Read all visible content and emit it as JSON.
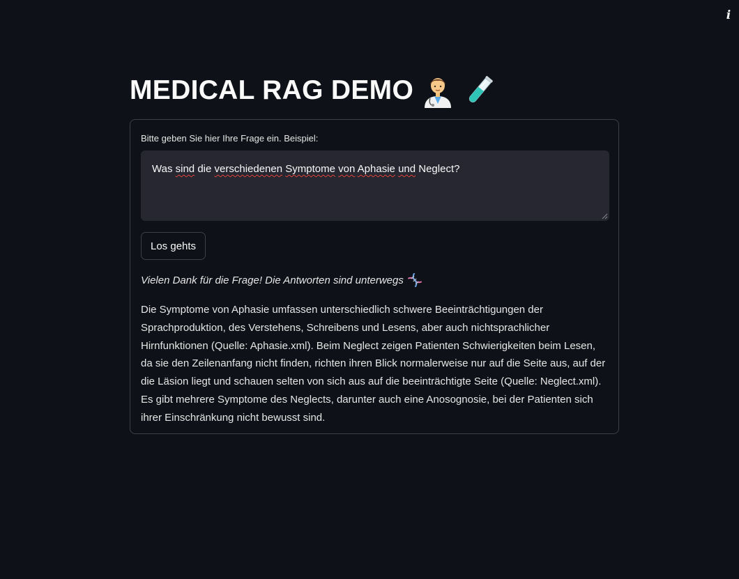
{
  "header": {
    "title": "MEDICAL RAG DEMO",
    "emojis": [
      "health-worker-emoji",
      "test-tube-emoji"
    ]
  },
  "toolbar": {
    "info_icon": "i"
  },
  "form": {
    "label": "Bitte geben Sie hier Ihre Frage ein. Beispiel:",
    "question_parts": [
      "Was ",
      "sind",
      " die ",
      "verschiedenen",
      " ",
      "Symptome",
      " ",
      "von",
      " ",
      "Aphasie",
      " ",
      "und",
      " Neglect?"
    ],
    "button_label": "Los gehts"
  },
  "response": {
    "thanks": "Vielen Dank für die Frage! Die Antworten sind unterwegs",
    "thanks_icon": "dna-icon",
    "answer": "Die Symptome von Aphasie umfassen unterschiedlich schwere Beeinträchtigungen der Sprachproduktion, des Verstehens, Schreibens und Lesens, aber auch nichtsprachlicher Hirnfunktionen (Quelle: Aphasie.xml). Beim Neglect zeigen Patienten Schwierigkeiten beim Lesen, da sie den Zeilenanfang nicht finden, richten ihren Blick normalerweise nur auf die Seite aus, auf der die Läsion liegt und schauen selten von sich aus auf die beeinträchtigte Seite (Quelle: Neglect.xml). Es gibt mehrere Symptome des Neglects, darunter auch eine Anosognosie, bei der Patienten sich ihrer Einschränkung nicht bewusst sind."
  },
  "colors": {
    "background": "#0e1117",
    "input_background": "#262730",
    "border": "#3d4048",
    "text": "#fafafa",
    "spellcheck": "#e0433b"
  }
}
